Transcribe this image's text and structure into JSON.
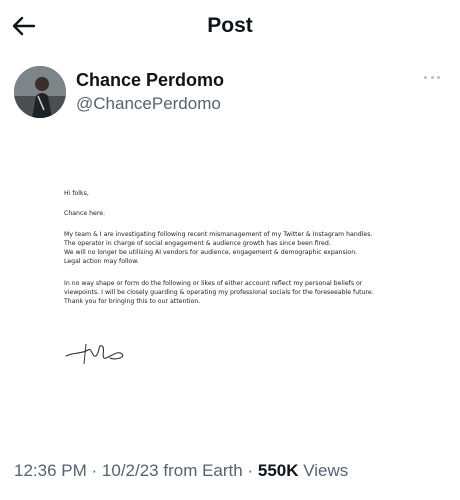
{
  "header": {
    "title": "Post"
  },
  "author": {
    "name": "Chance Perdomo",
    "handle": "@ChancePerdomo"
  },
  "letter": {
    "greeting": "Hi folks,",
    "intro": "Chance here.",
    "paragraph1": [
      "My team & I are investigating following recent mismanagement of my Twitter & Instagram handles.",
      "The operator in charge of social engagement & audience growth has since been fired.",
      "We will no longer be utilising AI vendors for audience, engagement & demographic expansion.",
      "Legal action may follow."
    ],
    "paragraph2": [
      "In no way shape or form do the following or likes of either account reflect my personal beliefs or",
      "viewpoints. I will be closely guarding & operating my professional socials for the foreseeable future.",
      "Thank you for bringing this to our attention."
    ]
  },
  "meta": {
    "time": "12:36 PM",
    "separator1": "·",
    "date": "10/2/23",
    "source": "from Earth",
    "separator2": "·",
    "views_count": "550K",
    "views_label": "Views"
  },
  "icons": {
    "back": "arrow-left-icon",
    "more": "more-dots-icon"
  }
}
